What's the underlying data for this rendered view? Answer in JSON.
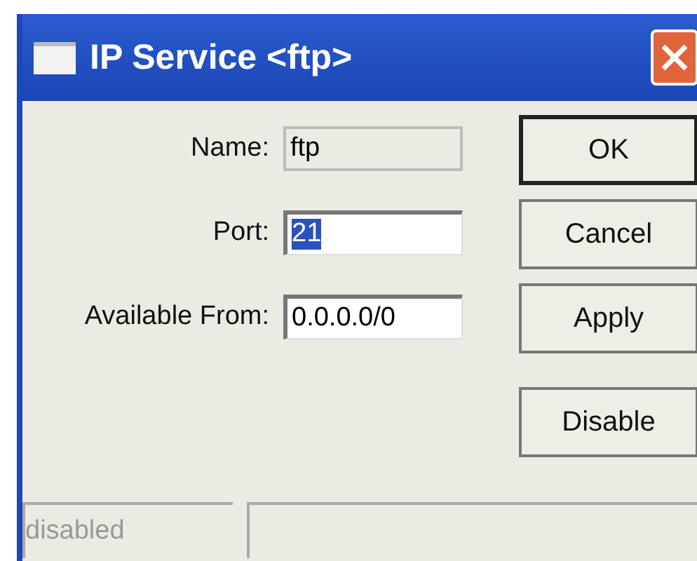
{
  "window": {
    "title": "IP Service <ftp>"
  },
  "fields": [
    {
      "label": "Name:",
      "value": "ftp",
      "disabled": true,
      "text_selected": false
    },
    {
      "label": "Port:",
      "value": "21",
      "disabled": false,
      "text_selected": true
    },
    {
      "label": "Available From:",
      "value": "0.0.0.0/0",
      "disabled": false,
      "text_selected": false
    }
  ],
  "buttons": [
    {
      "label": "OK",
      "default": true
    },
    {
      "label": "Cancel",
      "default": false
    },
    {
      "label": "Apply",
      "default": false
    },
    {
      "label": "Disable",
      "default": false
    }
  ],
  "status_bar": {
    "text": "disabled"
  }
}
